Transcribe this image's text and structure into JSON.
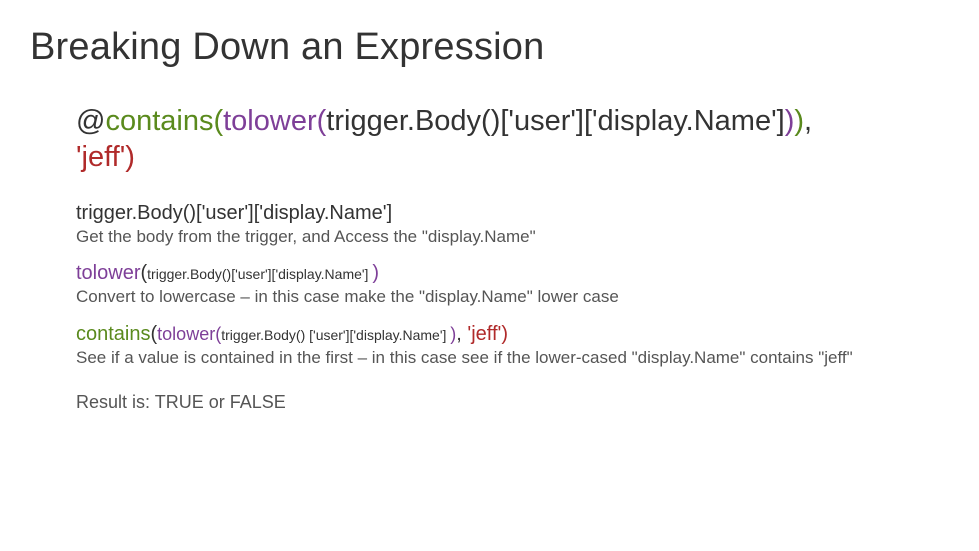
{
  "title": "Breaking Down an Expression",
  "expr": {
    "at": "@",
    "contains_open": "contains(",
    "tolower_open": "tolower(",
    "trigger": "trigger.Body()['user']['display.Name']",
    "tolower_close": ")",
    "contains_close": ")",
    "comma": ",",
    "jeff": "'jeff')"
  },
  "parts": [
    {
      "head": [
        {
          "t": "trigger.Body",
          "cls": "c-dark"
        },
        {
          "t": "()['user']['display.Name']",
          "cls": "c-dark"
        }
      ],
      "desc": "Get the body from the trigger, and Access the \"display.Name\""
    },
    {
      "head": [
        {
          "t": "tolower",
          "cls": "c-purple"
        },
        {
          "t": "(",
          "cls": "c-dark"
        },
        {
          "t": "trigger.Body()['user']['display.Name'] ",
          "cls": "c-dark",
          "sub": true
        },
        {
          "t": ")",
          "cls": "c-purple"
        }
      ],
      "desc": "Convert to lowercase – in this case make the \"display.Name\" lower case"
    },
    {
      "head": [
        {
          "t": "contains",
          "cls": "c-green"
        },
        {
          "t": "(",
          "cls": "c-dark"
        },
        {
          "t": "tolower(",
          "cls": "c-purple",
          "mid": true
        },
        {
          "t": "trigger.Body() ['user']['display.Name'] ",
          "cls": "c-dark",
          "sub": true
        },
        {
          "t": ")",
          "cls": "c-purple",
          "mid": true
        },
        {
          "t": ",",
          "cls": "c-dark"
        },
        {
          "t": " 'jeff')",
          "cls": "c-red"
        }
      ],
      "desc": "See if a value is contained in the first – in this case see if the lower-cased \"display.Name\" contains \"jeff\""
    }
  ],
  "result": "Result is: TRUE or FALSE"
}
